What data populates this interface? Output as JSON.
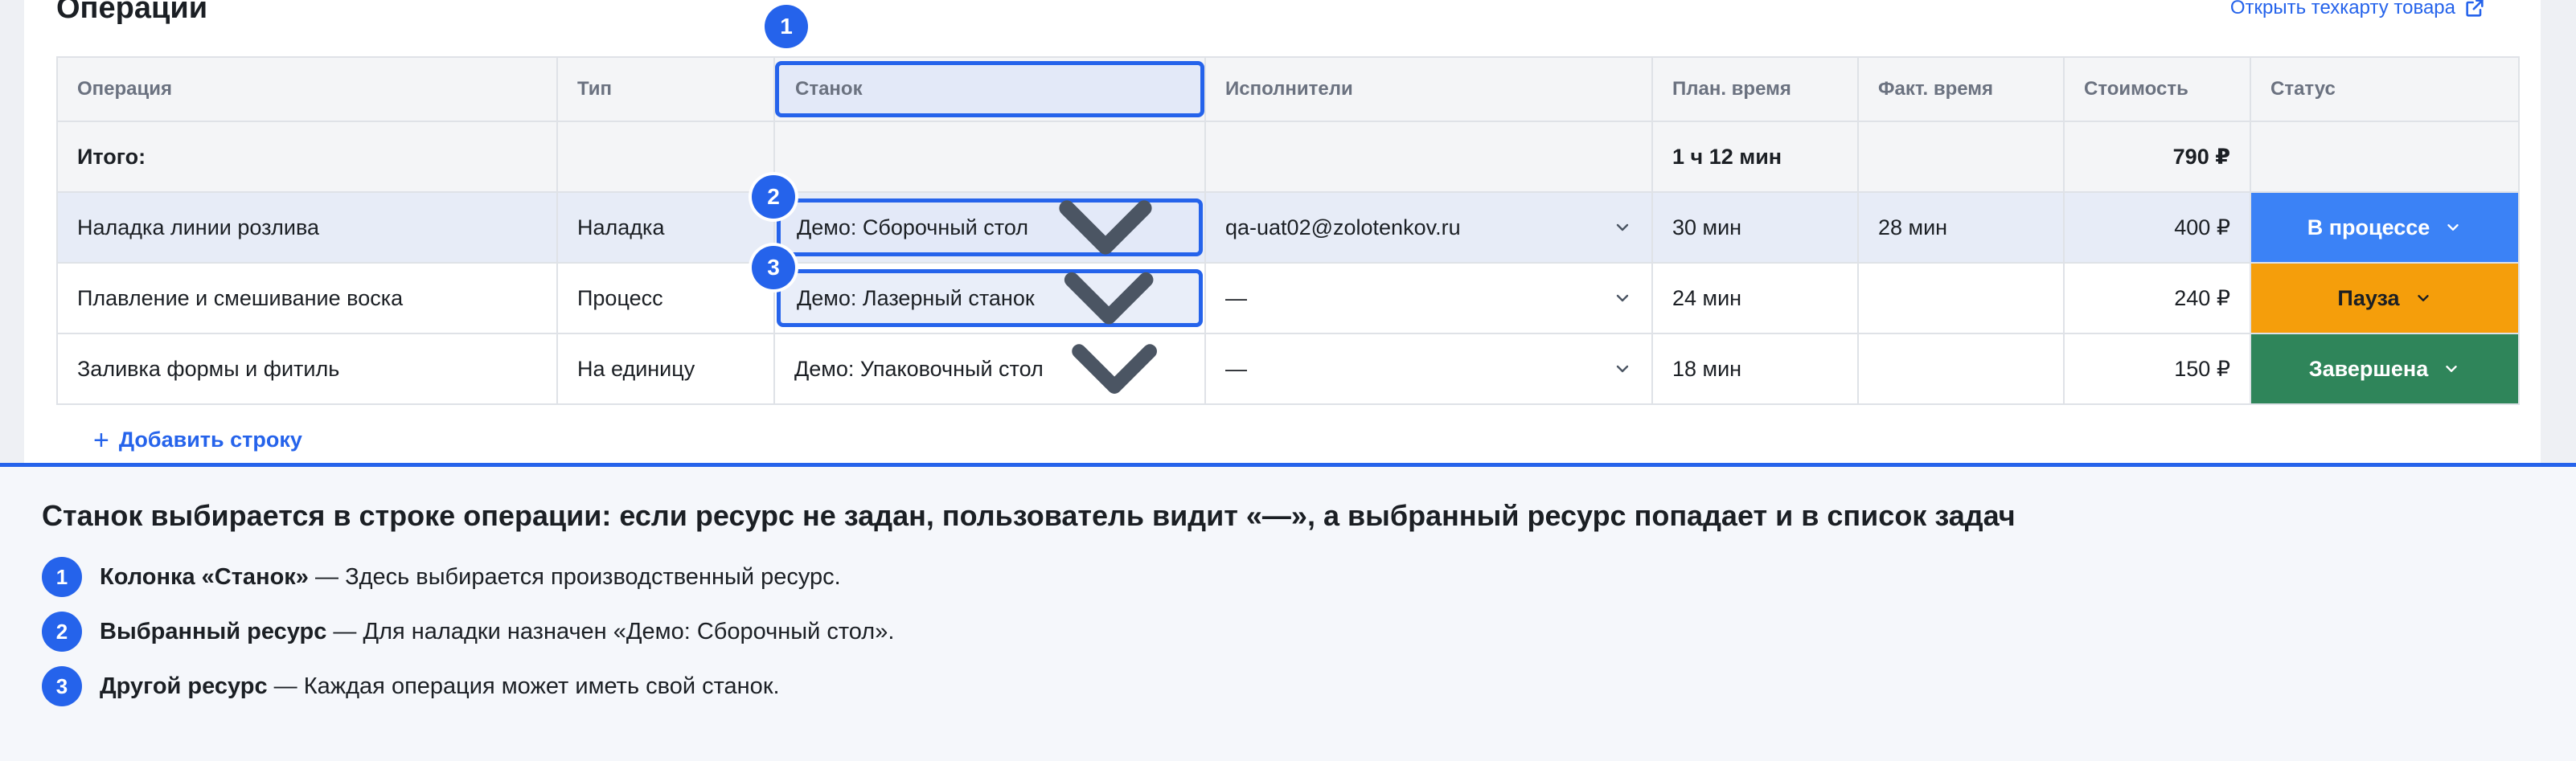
{
  "header": {
    "title": "Операции",
    "techcard_link": "Открыть техкарту товара"
  },
  "table": {
    "columns": [
      "Операция",
      "Тип",
      "Станок",
      "Исполнители",
      "План. время",
      "Факт. время",
      "Стоимость",
      "Статус"
    ],
    "total": {
      "label": "Итого:",
      "plan_time": "1 ч 12 мин",
      "cost": "790 ₽"
    },
    "rows": [
      {
        "operation": "Наладка линии розлива",
        "type": "Наладка",
        "machine": "Демо: Сборочный стол",
        "executors": "qa-uat02@zolotenkov.ru",
        "plan_time": "30 мин",
        "fact_time": "28 мин",
        "cost": "400 ₽",
        "status": "В процессе"
      },
      {
        "operation": "Плавление и смешивание воска",
        "type": "Процесс",
        "machine": "Демо: Лазерный станок",
        "executors": "—",
        "plan_time": "24 мин",
        "fact_time": "",
        "cost": "240 ₽",
        "status": "Пауза"
      },
      {
        "operation": "Заливка формы и фитиль",
        "type": "На единицу",
        "machine": "Демо: Упаковочный стол",
        "executors": "—",
        "plan_time": "18 мин",
        "fact_time": "",
        "cost": "150 ₽",
        "status": "Завершена"
      }
    ],
    "add_row": "Добавить строку"
  },
  "markers": [
    "1",
    "2",
    "3"
  ],
  "callout": {
    "heading": "Станок выбирается в строке операции: если ресурс не задан, пользователь видит «—», а выбранный ресурс попадает и в список задач",
    "notes": [
      {
        "num": "1",
        "title": "Колонка «Станок»",
        "text": " — Здесь выбирается производственный ресурс."
      },
      {
        "num": "2",
        "title": "Выбранный ресурс",
        "text": " — Для наладки назначен «Демо: Сборочный стол»."
      },
      {
        "num": "3",
        "title": "Другой ресурс",
        "text": " — Каждая операция может иметь свой станок."
      }
    ]
  },
  "colors": {
    "accent": "#2563eb",
    "status_in_progress": "#3b82f6",
    "status_pause": "#f59e0b",
    "status_done": "#2f855a"
  }
}
